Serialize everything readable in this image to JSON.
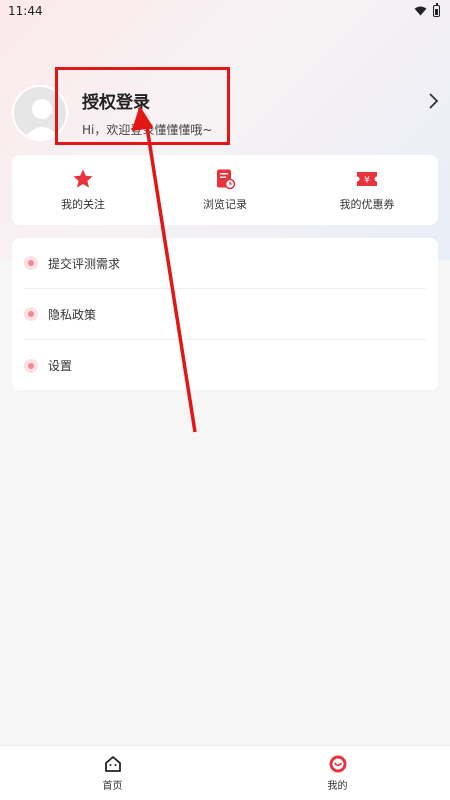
{
  "status_bar": {
    "time": "11:44"
  },
  "profile": {
    "title": "授权登录",
    "subtitle": "Hi，欢迎登录懂懂懂哦~"
  },
  "quick_actions": [
    {
      "label": "我的关注",
      "icon": "star-icon"
    },
    {
      "label": "浏览记录",
      "icon": "history-icon"
    },
    {
      "label": "我的优惠券",
      "icon": "coupon-icon"
    }
  ],
  "menu": [
    {
      "label": "提交评测需求",
      "icon": "submit-icon"
    },
    {
      "label": "隐私政策",
      "icon": "lock-icon"
    },
    {
      "label": "设置",
      "icon": "settings-icon"
    }
  ],
  "tabbar": [
    {
      "label": "首页",
      "icon": "home-icon",
      "active": false
    },
    {
      "label": "我的",
      "icon": "profile-icon",
      "active": true
    }
  ],
  "colors": {
    "accent": "#e8323c",
    "annotation": "#e31616"
  }
}
